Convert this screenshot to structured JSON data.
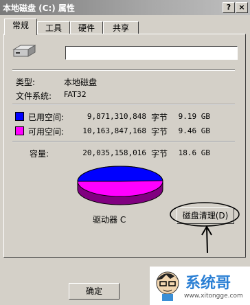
{
  "window": {
    "title": "本地磁盘 (C:) 属性",
    "help_label": "?",
    "close_label": "×"
  },
  "tabs": [
    {
      "label": "常规"
    },
    {
      "label": "工具"
    },
    {
      "label": "硬件"
    },
    {
      "label": "共享"
    }
  ],
  "general": {
    "volume_label_value": "",
    "type_label": "类型:",
    "type_value": "本地磁盘",
    "fs_label": "文件系统:",
    "fs_value": "FAT32",
    "used": {
      "label": "已用空间:",
      "bytes": "9,871,310,848",
      "unit": "字节",
      "size": "9.19 GB",
      "color": "#0000ff"
    },
    "free": {
      "label": "可用空间:",
      "bytes": "10,163,847,168",
      "unit": "字节",
      "size": "9.46 GB",
      "color": "#ff00ff"
    },
    "capacity": {
      "label": "容量:",
      "bytes": "20,035,158,016",
      "unit": "字节",
      "size": "18.6 GB"
    },
    "drive_label": "驱动器 C",
    "cleanup_button": "磁盘清理(D)"
  },
  "footer": {
    "ok_label": "确定"
  },
  "watermark": {
    "brand": "系统哥",
    "url": "www.xitongge.com"
  }
}
